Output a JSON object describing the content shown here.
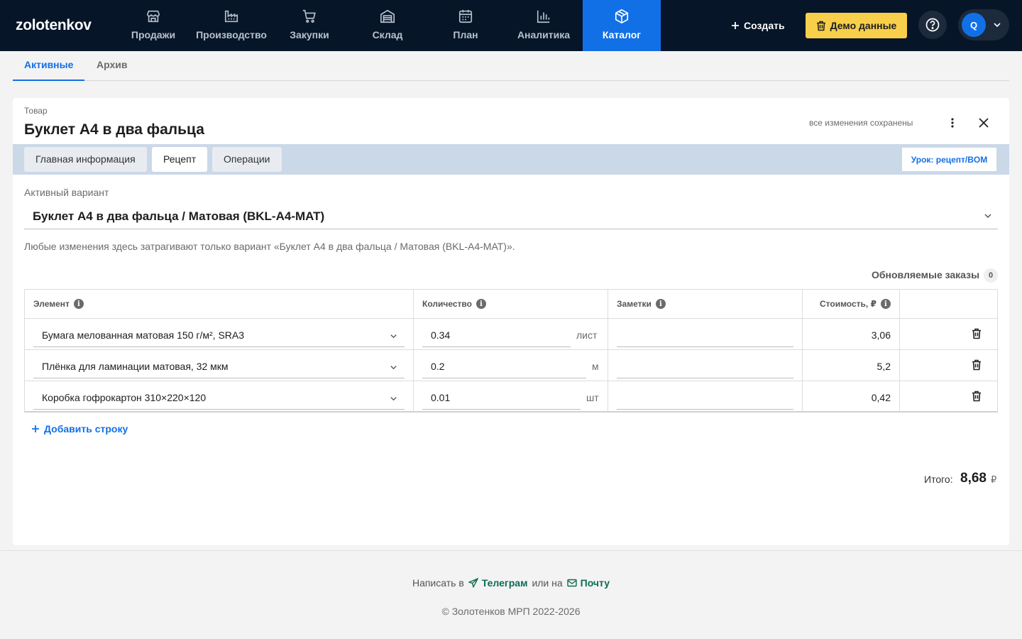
{
  "brand": "zolotenkov",
  "nav": [
    {
      "label": "Продажи",
      "icon": "store-icon"
    },
    {
      "label": "Производство",
      "icon": "factory-icon"
    },
    {
      "label": "Закупки",
      "icon": "cart-icon"
    },
    {
      "label": "Склад",
      "icon": "warehouse-icon"
    },
    {
      "label": "План",
      "icon": "calendar-icon"
    },
    {
      "label": "Аналитика",
      "icon": "bar-chart-icon"
    },
    {
      "label": "Каталог",
      "icon": "box-icon",
      "active": true
    }
  ],
  "header": {
    "create_label": "Создать",
    "demo_label": "Демо данные",
    "avatar_letter": "Q"
  },
  "archive_tabs": [
    "Активные",
    "Архив"
  ],
  "card": {
    "kind": "Товар",
    "title": "Буклет А4 в два фальца",
    "saved_status": "все изменения сохранены",
    "tabs": [
      "Главная информация",
      "Рецепт",
      "Операции"
    ],
    "active_tab": "Рецепт",
    "lesson_link": "Урок: рецепт/BOM"
  },
  "variant": {
    "label": "Активный вариант",
    "value": "Буклет А4 в два фальца / Матовая (BKL-A4-MAT)",
    "note": "Любые изменения здесь затрагивают только вариант «Буклет А4 в два фальца / Матовая (BKL-A4-MAT)»."
  },
  "orders": {
    "label": "Обновляемые заказы",
    "count": "0"
  },
  "table": {
    "headers": {
      "item": "Элемент",
      "qty": "Количество",
      "notes": "Заметки",
      "cost": "Стоимость, ₽"
    },
    "rows": [
      {
        "item": "Бумага мелованная матовая 150 г/м², SRA3",
        "qty": "0.34",
        "unit": "лист",
        "note": "",
        "cost": "3,06"
      },
      {
        "item": "Плёнка для ламинации матовая, 32 мкм",
        "qty": "0.2",
        "unit": "м",
        "note": "",
        "cost": "5,2"
      },
      {
        "item": "Коробка гофрокартон 310×220×120",
        "qty": "0.01",
        "unit": "шт",
        "note": "",
        "cost": "0,42"
      }
    ]
  },
  "add_row_label": "Добавить строку",
  "total": {
    "label": "Итого:",
    "value": "8,68",
    "currency": "₽"
  },
  "footer": {
    "write_in": "Написать в",
    "telegram": "Телеграм",
    "or_to": "или на",
    "mail": "Почту",
    "copyright": "© Золотенков МРП 2022-2026"
  },
  "colors": {
    "nav_bg": "#061528",
    "accent": "#1270e6",
    "demo_bg": "#f8cf4a",
    "tabs_band": "#cbd8e8",
    "footer_link": "#0e6b52"
  }
}
